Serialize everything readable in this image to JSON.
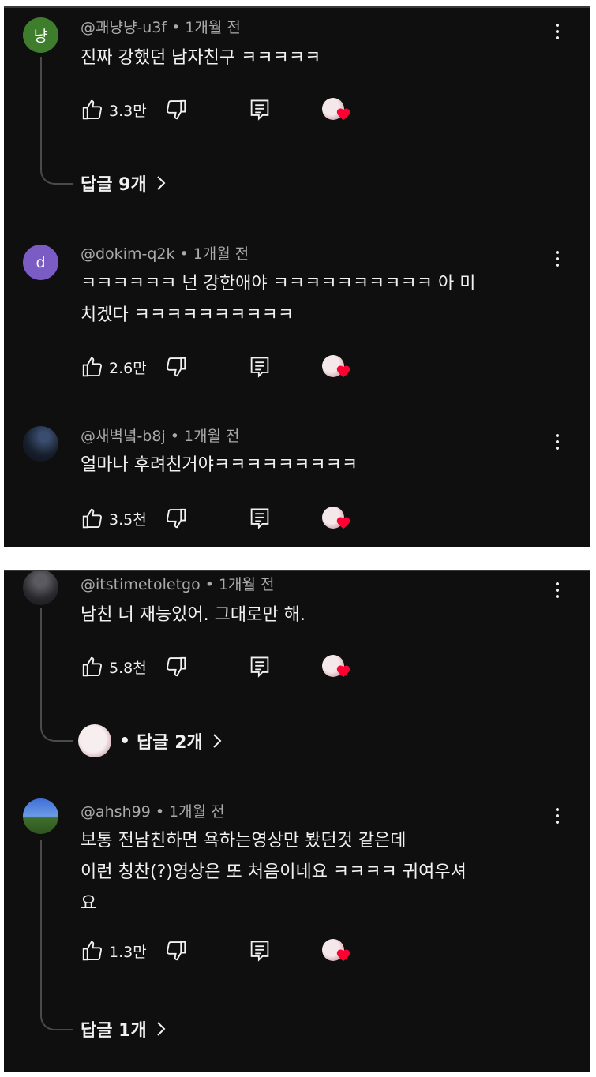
{
  "colors": {
    "background": "#0f0f0f",
    "text": "#f1f1f1",
    "muted": "#aaaaaa",
    "heart": "#ff0033"
  },
  "screenshot1": {
    "comments": [
      {
        "avatar_letter": "냥",
        "avatar_color": "#3e7d2c",
        "author": "@괘냥냥-u3f",
        "time": "1개월 전",
        "lines": [
          "진짜 강했던 남자친구 ㅋㅋㅋㅋㅋ"
        ],
        "likes": "3.3만",
        "replies_label": "답글 9개"
      },
      {
        "avatar_letter": "d",
        "avatar_color": "#7b5bc4",
        "author": "@dokim-q2k",
        "time": "1개월 전",
        "lines": [
          "ㅋㅋㅋㅋㅋㅋ 넌 강한애야 ㅋㅋㅋㅋㅋㅋㅋㅋㅋㅋ 아 미",
          "치겠다 ㅋㅋㅋㅋㅋㅋㅋㅋㅋㅋ"
        ],
        "likes": "2.6만"
      },
      {
        "avatar_color": "#1b2436",
        "author": "@새벽녘-b8j",
        "time": "1개월 전",
        "lines": [
          "얼마나 후려친거야ㅋㅋㅋㅋㅋㅋㅋㅋㅋ"
        ],
        "likes": "3.5천"
      }
    ]
  },
  "screenshot2": {
    "comments": [
      {
        "avatar_color": "#2a2a2e",
        "author": "@itstimetoletgo",
        "time": "1개월 전",
        "lines": [
          "남친 너 재능있어. 그대로만 해."
        ],
        "likes": "5.8천",
        "replies_label": "답글 2개",
        "replies_dot": "•"
      },
      {
        "avatar_color": "#3d66c9",
        "author": "@ahsh99",
        "time": "1개월 전",
        "lines": [
          "보통 전남친하면 욕하는영상만 봤던것 같은데",
          "이런 칭찬(?)영상은 또 처음이네요 ㅋㅋㅋㅋ 귀여우셔",
          "요"
        ],
        "likes": "1.3만",
        "replies_label": "답글 1개"
      }
    ]
  },
  "icons": [
    "thumbs-up-icon",
    "thumbs-down-icon",
    "reply-icon",
    "creator-heart-icon",
    "kebab-menu-icon",
    "chevron-right-icon"
  ],
  "separator": "•"
}
